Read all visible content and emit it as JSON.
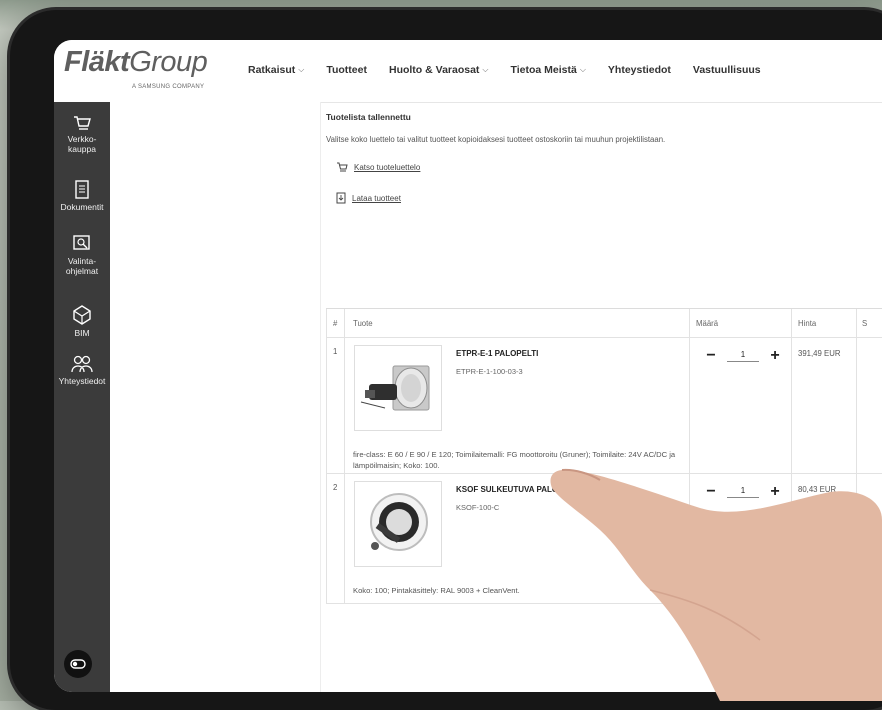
{
  "logo": {
    "brand_bold": "Fläkt",
    "brand_light": "Group",
    "tagline": "A SAMSUNG COMPANY"
  },
  "nav": [
    {
      "label": "Ratkaisut",
      "dropdown": true
    },
    {
      "label": "Tuotteet",
      "dropdown": false
    },
    {
      "label": "Huolto & Varaosat",
      "dropdown": true
    },
    {
      "label": "Tietoa Meistä",
      "dropdown": true
    },
    {
      "label": "Yhteystiedot",
      "dropdown": false
    },
    {
      "label": "Vastuullisuus",
      "dropdown": false
    }
  ],
  "sidebar": {
    "items": [
      {
        "label": "Verkko-\nkauppa",
        "icon": "cart-icon"
      },
      {
        "label": "Dokumentit",
        "icon": "document-icon"
      },
      {
        "label": "Valinta-\nohjelmat",
        "icon": "selection-tool-icon"
      },
      {
        "label": "BIM",
        "icon": "cube-icon"
      },
      {
        "label": "Yhteystiedot",
        "icon": "people-icon"
      }
    ],
    "toggle_icon": "collapse-toggle-icon"
  },
  "content": {
    "saved_title": "Tuotelista tallennettu",
    "saved_desc": "Valitse koko luettelo tai valitut tuotteet kopioidaksesi tuotteet ostoskoriin tai muuhun projektilistaan.",
    "link_view": "Katso tuoteluettelo",
    "link_download": "Lataa tuotteet"
  },
  "table": {
    "headers": {
      "num": "#",
      "product": "Tuote",
      "qty": "Määrä",
      "price": "Hinta",
      "extra": "S"
    },
    "rows": [
      {
        "num": "1",
        "name": "ETPR-E-1 PALOPELTI",
        "code": "ETPR-E-1-100-03-3",
        "desc": "fire-class: E 60 / E 90 / E 120; Toimilaitemalli: FG moottoroitu (Gruner); Toimilaite: 24V AC/DC ja lämpöilmaisin; Koko: 100.",
        "qty": "1",
        "price": "391,49 EUR"
      },
      {
        "num": "2",
        "name": "KSOF SULKEUTUVA PALOPELTIVENTTIILI",
        "code": "KSOF-100-C",
        "desc": "Koko: 100; Pintakäsittely: RAL 9003 + CleanVent.",
        "qty": "1",
        "price": "80,43 EUR"
      }
    ]
  }
}
